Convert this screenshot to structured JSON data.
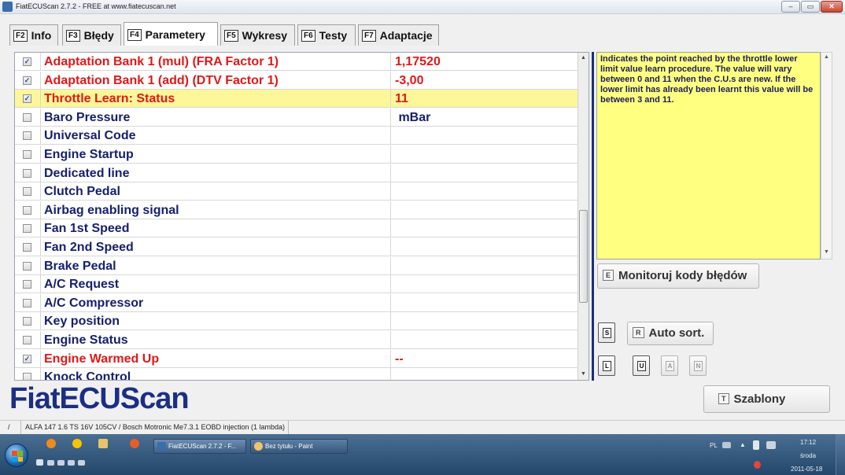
{
  "window": {
    "title": "FiatECUScan 2.7.2 - FREE at www.fiatecuscan.net",
    "controls": {
      "minimize": "–",
      "maximize": "▭",
      "close": "✕"
    }
  },
  "tabs": [
    {
      "key": "F2",
      "label": "Info"
    },
    {
      "key": "F3",
      "label": "Błędy"
    },
    {
      "key": "F4",
      "label": "Parametery"
    },
    {
      "key": "F5",
      "label": "Wykresy"
    },
    {
      "key": "F6",
      "label": "Testy"
    },
    {
      "key": "F7",
      "label": "Adaptacje"
    }
  ],
  "active_tab": "Parametery",
  "parameters": [
    {
      "checked": true,
      "name": "Adaptation Bank 1 (mul) (FRA Factor 1)",
      "value": "1,17520",
      "color": "#e01818"
    },
    {
      "checked": true,
      "name": "Adaptation Bank 1 (add) (DTV Factor 1)",
      "value": "-3,00",
      "color": "#e01818"
    },
    {
      "checked": true,
      "name": "Throttle Learn: Status",
      "value": "11",
      "color": "#e01818",
      "highlight": true
    },
    {
      "checked": false,
      "name": "Baro Pressure",
      "value": " mBar",
      "color": "#16206e"
    },
    {
      "checked": false,
      "name": "Universal Code",
      "value": "",
      "color": "#16206e"
    },
    {
      "checked": false,
      "name": "Engine Startup",
      "value": "",
      "color": "#16206e"
    },
    {
      "checked": false,
      "name": "Dedicated line",
      "value": "",
      "color": "#16206e"
    },
    {
      "checked": false,
      "name": "Clutch Pedal",
      "value": "",
      "color": "#16206e"
    },
    {
      "checked": false,
      "name": "Airbag enabling signal",
      "value": "",
      "color": "#16206e"
    },
    {
      "checked": false,
      "name": "Fan 1st Speed",
      "value": "",
      "color": "#16206e"
    },
    {
      "checked": false,
      "name": "Fan 2nd Speed",
      "value": "",
      "color": "#16206e"
    },
    {
      "checked": false,
      "name": "Brake Pedal",
      "value": "",
      "color": "#16206e"
    },
    {
      "checked": false,
      "name": "A/C Request",
      "value": "",
      "color": "#16206e"
    },
    {
      "checked": false,
      "name": "A/C Compressor",
      "value": "",
      "color": "#16206e"
    },
    {
      "checked": false,
      "name": "Key position",
      "value": "",
      "color": "#16206e"
    },
    {
      "checked": false,
      "name": "Engine Status",
      "value": "",
      "color": "#16206e"
    },
    {
      "checked": true,
      "name": "Engine Warmed Up",
      "value": "--",
      "color": "#e01818"
    },
    {
      "checked": false,
      "name": "Knock Control",
      "value": "",
      "color": "#16206e"
    }
  ],
  "description": "Indicates the point reached by the throttle lower limit value learn procedure. The value will vary between 0 and 11  when the C.U.s are new. If the lower limit has already been learnt this value will be between 3 and 11.",
  "buttons": {
    "monitor": {
      "key": "E",
      "label": "Monitoruj kody błędów"
    },
    "s": {
      "key": "S"
    },
    "autosort": {
      "key": "R",
      "label": "Auto sort."
    },
    "l": {
      "key": "L"
    },
    "u": {
      "key": "U"
    },
    "a": {
      "key": "A"
    },
    "n": {
      "key": "N"
    },
    "templates": {
      "key": "T",
      "label": "Szablony"
    }
  },
  "logo": "FiatECUScan",
  "statusbar": {
    "cell1": "/",
    "vehicle": "ALFA 147 1.6 TS 16V 105CV / Bosch Motronic Me7.3.1 EOBD injection (1 lambda)"
  },
  "taskbar": {
    "tasks": [
      {
        "label": "FiatECUScan 2.7.2 - F...",
        "active": true
      },
      {
        "label": "Bez tytułu - Paint",
        "active": false
      }
    ],
    "tray": {
      "lang": "PL",
      "time": "17:12",
      "day": "środa",
      "date": "2011-05-18"
    }
  }
}
